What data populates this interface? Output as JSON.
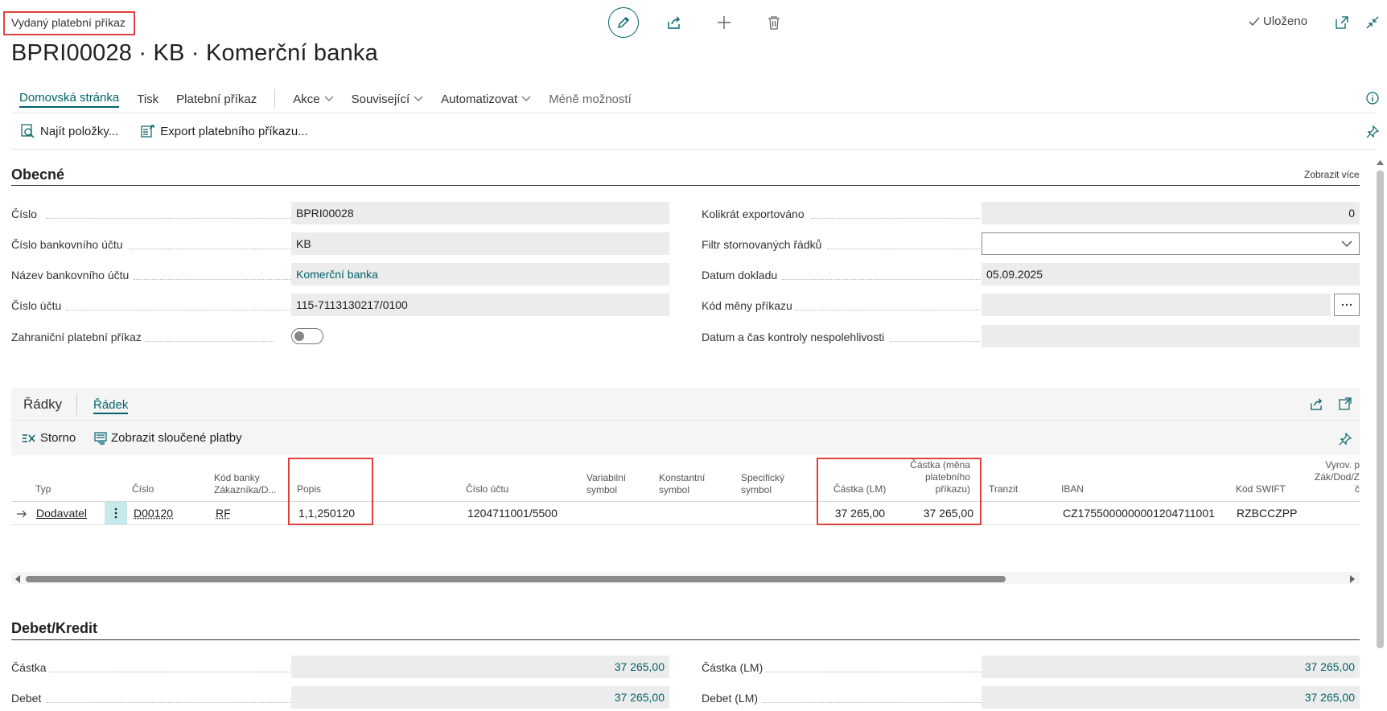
{
  "header": {
    "caption": "Vydaný platební příkaz",
    "title": "BPRI00028 · KB · Komerční banka",
    "saved": "Uloženo"
  },
  "nav": {
    "tabs": [
      {
        "label": "Domovská stránka"
      },
      {
        "label": "Tisk"
      },
      {
        "label": "Platební příkaz"
      },
      {
        "label": "Akce"
      },
      {
        "label": "Související"
      },
      {
        "label": "Automatizovat"
      },
      {
        "label": "Méně možností"
      }
    ]
  },
  "actions": {
    "find_entries": "Najít položky...",
    "export": "Export platebního příkazu..."
  },
  "general": {
    "title": "Obecné",
    "show_more": "Zobrazit více",
    "left": [
      {
        "label": "Číslo",
        "value": "BPRI00028"
      },
      {
        "label": "Číslo bankovního účtu",
        "value": "KB"
      },
      {
        "label": "Název bankovního účtu",
        "value": "Komerční banka"
      },
      {
        "label": "Číslo účtu",
        "value": "115-7113130217/0100"
      },
      {
        "label": "Zahraniční platební příkaz",
        "value": ""
      }
    ],
    "right": [
      {
        "label": "Kolikrát exportováno",
        "value": "0"
      },
      {
        "label": "Filtr stornovaných řádků",
        "value": ""
      },
      {
        "label": "Datum dokladu",
        "value": "05.09.2025"
      },
      {
        "label": "Kód měny příkazu",
        "value": ""
      },
      {
        "label": "Datum a čas kontroly nespolehlivosti",
        "value": ""
      }
    ]
  },
  "lines": {
    "tab_lines": "Řádky",
    "tab_line": "Řádek",
    "storno": "Storno",
    "merged": "Zobrazit sloučené platby",
    "columns": {
      "typ": "Typ",
      "cislo": "Číslo",
      "kod_banky_1": "Kód banky",
      "kod_banky_2": "Zákazníka/D...",
      "popis": "Popis",
      "cislo_uctu": "Číslo účtu",
      "var_1": "Variabilní",
      "var_2": "symbol",
      "konst_1": "Konstantní",
      "konst_2": "symbol",
      "spec_1": "Specifický",
      "spec_2": "symbol",
      "castka_lm": "Částka (LM)",
      "castka_mena_1": "Částka (měna",
      "castka_mena_2": "platebního",
      "castka_mena_3": "příkazu)",
      "tranzit": "Tranzit",
      "iban": "IBAN",
      "swift": "Kód SWIFT",
      "vyrov_1": "Vyrov. p",
      "vyrov_2": "Zák/Dod/Z",
      "vyrov_3": "č"
    },
    "row": {
      "typ": "Dodavatel",
      "cislo": "D00120",
      "kod_banky": "RF",
      "popis": "1,1,250120",
      "cislo_uctu": "1204711001/5500",
      "castka_lm": "37 265,00",
      "castka_mena": "37 265,00",
      "iban": "CZ1755000000001204711001",
      "swift": "RZBCCZPP"
    }
  },
  "debit_credit": {
    "title": "Debet/Kredit",
    "left": [
      {
        "label": "Částka",
        "value": "37 265,00"
      },
      {
        "label": "Debet",
        "value": "37 265,00"
      }
    ],
    "right": [
      {
        "label": "Částka (LM)",
        "value": "37 265,00"
      },
      {
        "label": "Debet (LM)",
        "value": "37 265,00"
      }
    ]
  },
  "colors": {
    "accent": "#00626b",
    "highlight": "#e0403f"
  }
}
